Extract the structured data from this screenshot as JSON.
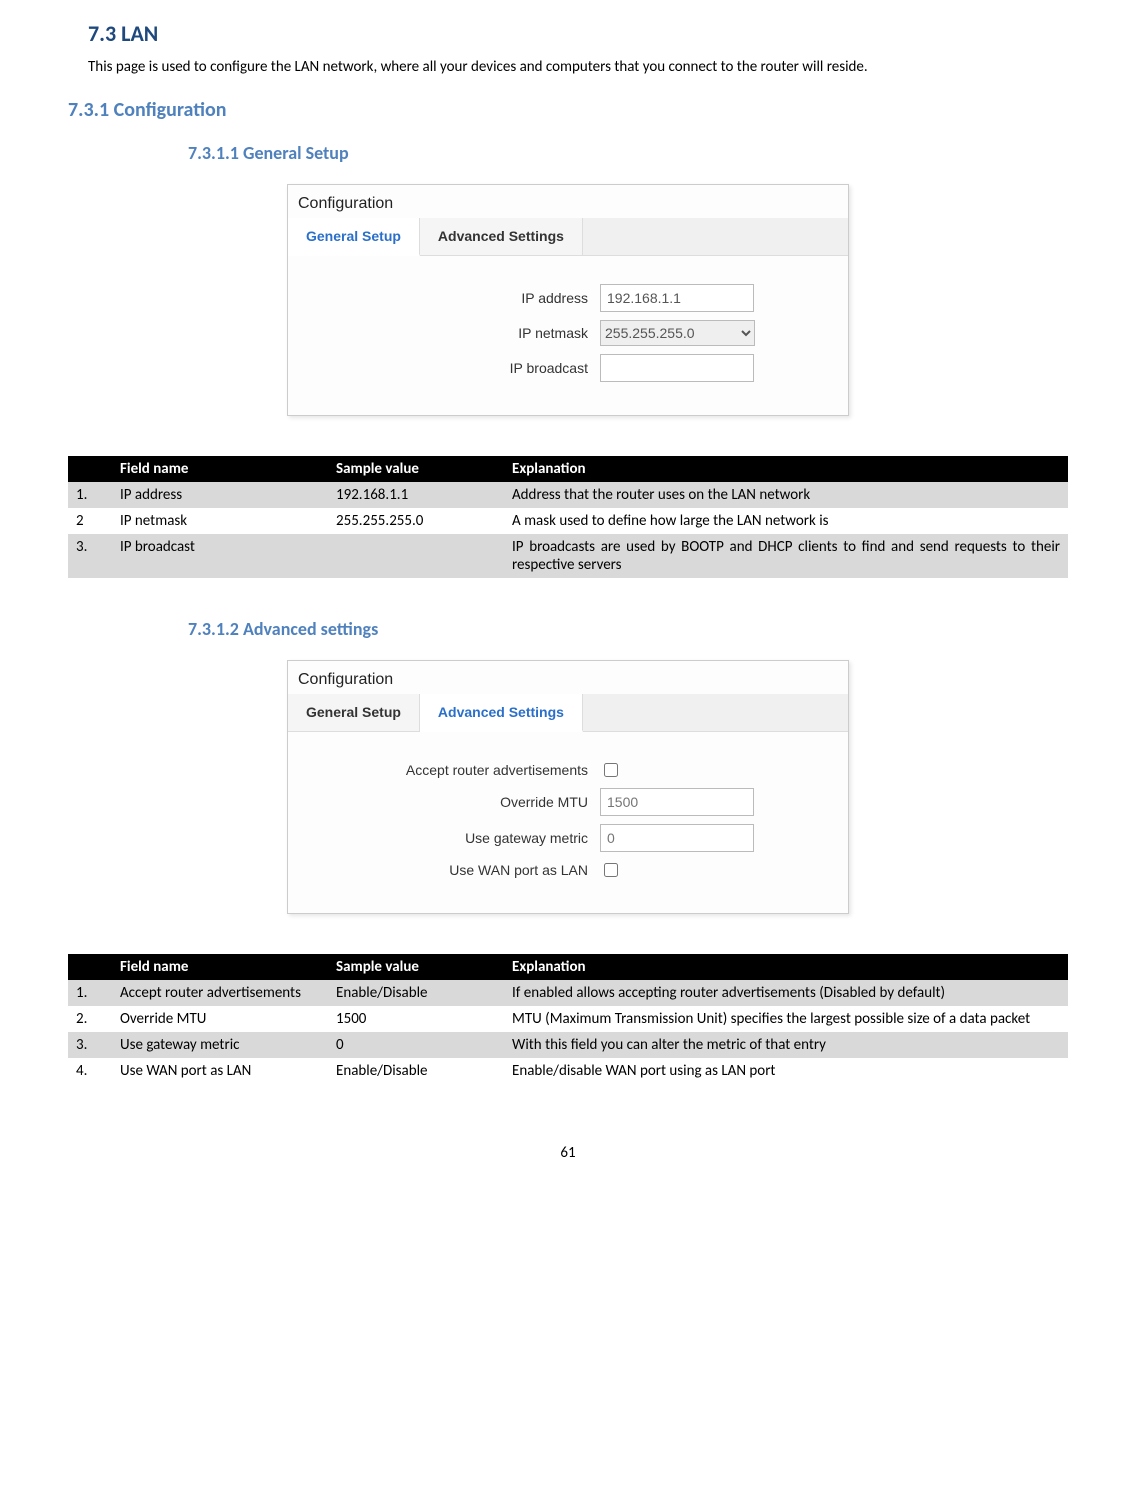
{
  "headings": {
    "h2": "7.3   LAN",
    "intro": "This page is used to configure the LAN network, where all your devices and computers that you connect to the router will reside.",
    "h3": "7.3.1 Configuration",
    "h4a": "7.3.1.1   General Setup",
    "h4b": "7.3.1.2   Advanced settings"
  },
  "config1": {
    "title": "Configuration",
    "tabs": {
      "general": "General Setup",
      "advanced": "Advanced Settings"
    },
    "fields": {
      "ip_address_label": "IP address",
      "ip_address_value": "192.168.1.1",
      "ip_netmask_label": "IP netmask",
      "ip_netmask_value": "255.255.255.0",
      "ip_broadcast_label": "IP broadcast",
      "ip_broadcast_value": ""
    }
  },
  "table1": {
    "headers": {
      "num": "",
      "name": "Field name",
      "sample": "Sample value",
      "explain": "Explanation"
    },
    "rows": [
      {
        "num": "1.",
        "name": "IP address",
        "sample": "192.168.1.1",
        "explain": "Address that the router uses on the LAN network"
      },
      {
        "num": "2",
        "name": "IP netmask",
        "sample": "255.255.255.0",
        "explain": "A mask used to define how large the LAN network is"
      },
      {
        "num": "3.",
        "name": "IP broadcast",
        "sample": "",
        "explain": "IP broadcasts are used by BOOTP and DHCP clients to find and send requests to their respective servers"
      }
    ]
  },
  "config2": {
    "title": "Configuration",
    "tabs": {
      "general": "General Setup",
      "advanced": "Advanced Settings"
    },
    "fields": {
      "accept_ra_label": "Accept router advertisements",
      "override_mtu_label": "Override MTU",
      "override_mtu_value": "1500",
      "gateway_metric_label": "Use gateway metric",
      "gateway_metric_value": "0",
      "wan_as_lan_label": "Use WAN port as LAN"
    }
  },
  "table2": {
    "headers": {
      "num": "",
      "name": "Field name",
      "sample": "Sample value",
      "explain": "Explanation"
    },
    "rows": [
      {
        "num": "1.",
        "name": "Accept router advertisements",
        "sample": "Enable/Disable",
        "explain": "If enabled allows accepting router advertisements (Disabled by default)"
      },
      {
        "num": "2.",
        "name": "Override MTU",
        "sample": "1500",
        "explain": "MTU (Maximum Transmission Unit) specifies the largest possible size of a data packet"
      },
      {
        "num": "3.",
        "name": "Use gateway metric",
        "sample": "0",
        "explain": "With this field you can alter the metric of that entry"
      },
      {
        "num": "4.",
        "name": "Use WAN port as LAN",
        "sample": "Enable/Disable",
        "explain": "Enable/disable WAN port using as LAN port"
      }
    ]
  },
  "page_number": "61"
}
